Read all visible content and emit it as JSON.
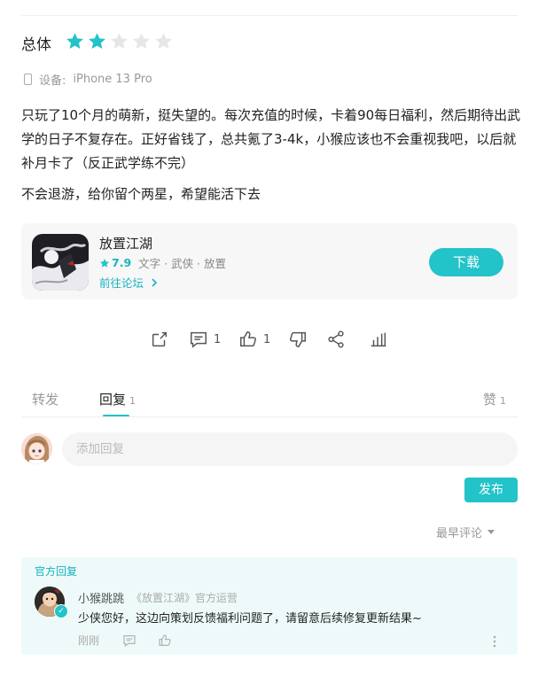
{
  "review": {
    "rating_label": "总体",
    "rating": 2,
    "max_rating": 5,
    "device_label": "设备:",
    "device_value": "iPhone 13 Pro",
    "paragraph1": "只玩了10个月的萌新，挺失望的。每次充值的时候，卡着90每日福利，然后期待出武学的日子不复存在。正好省钱了，总共氪了3-4k，小猴应该也不会重视我吧，以后就补月卡了（反正武学练不完）",
    "paragraph2": "不会退游，给你留个两星，希望能活下去"
  },
  "game": {
    "name": "放置江湖",
    "score": "7.9",
    "tags": "文字 · 武侠 · 放置",
    "forum_link": "前往论坛",
    "download_label": "下载"
  },
  "actions": {
    "comment_count": "1",
    "like_count": "1"
  },
  "tabs": {
    "repost": "转发",
    "reply": "回复",
    "reply_count": "1",
    "likes": "赞",
    "likes_count": "1"
  },
  "composer": {
    "placeholder": "添加回复",
    "publish_label": "发布"
  },
  "sort": {
    "label": "最早评论"
  },
  "official_reply": {
    "label": "官方回复",
    "name": "小猴跳跳",
    "tag": "《放置江湖》官方运营",
    "text": "少侠您好，这边向策划反馈福利问题了，请留意后续修复更新结果~",
    "time": "刚刚"
  },
  "colors": {
    "accent": "#22c3c9",
    "star_on": "#22c3c9",
    "star_off": "#e6e6e6"
  }
}
